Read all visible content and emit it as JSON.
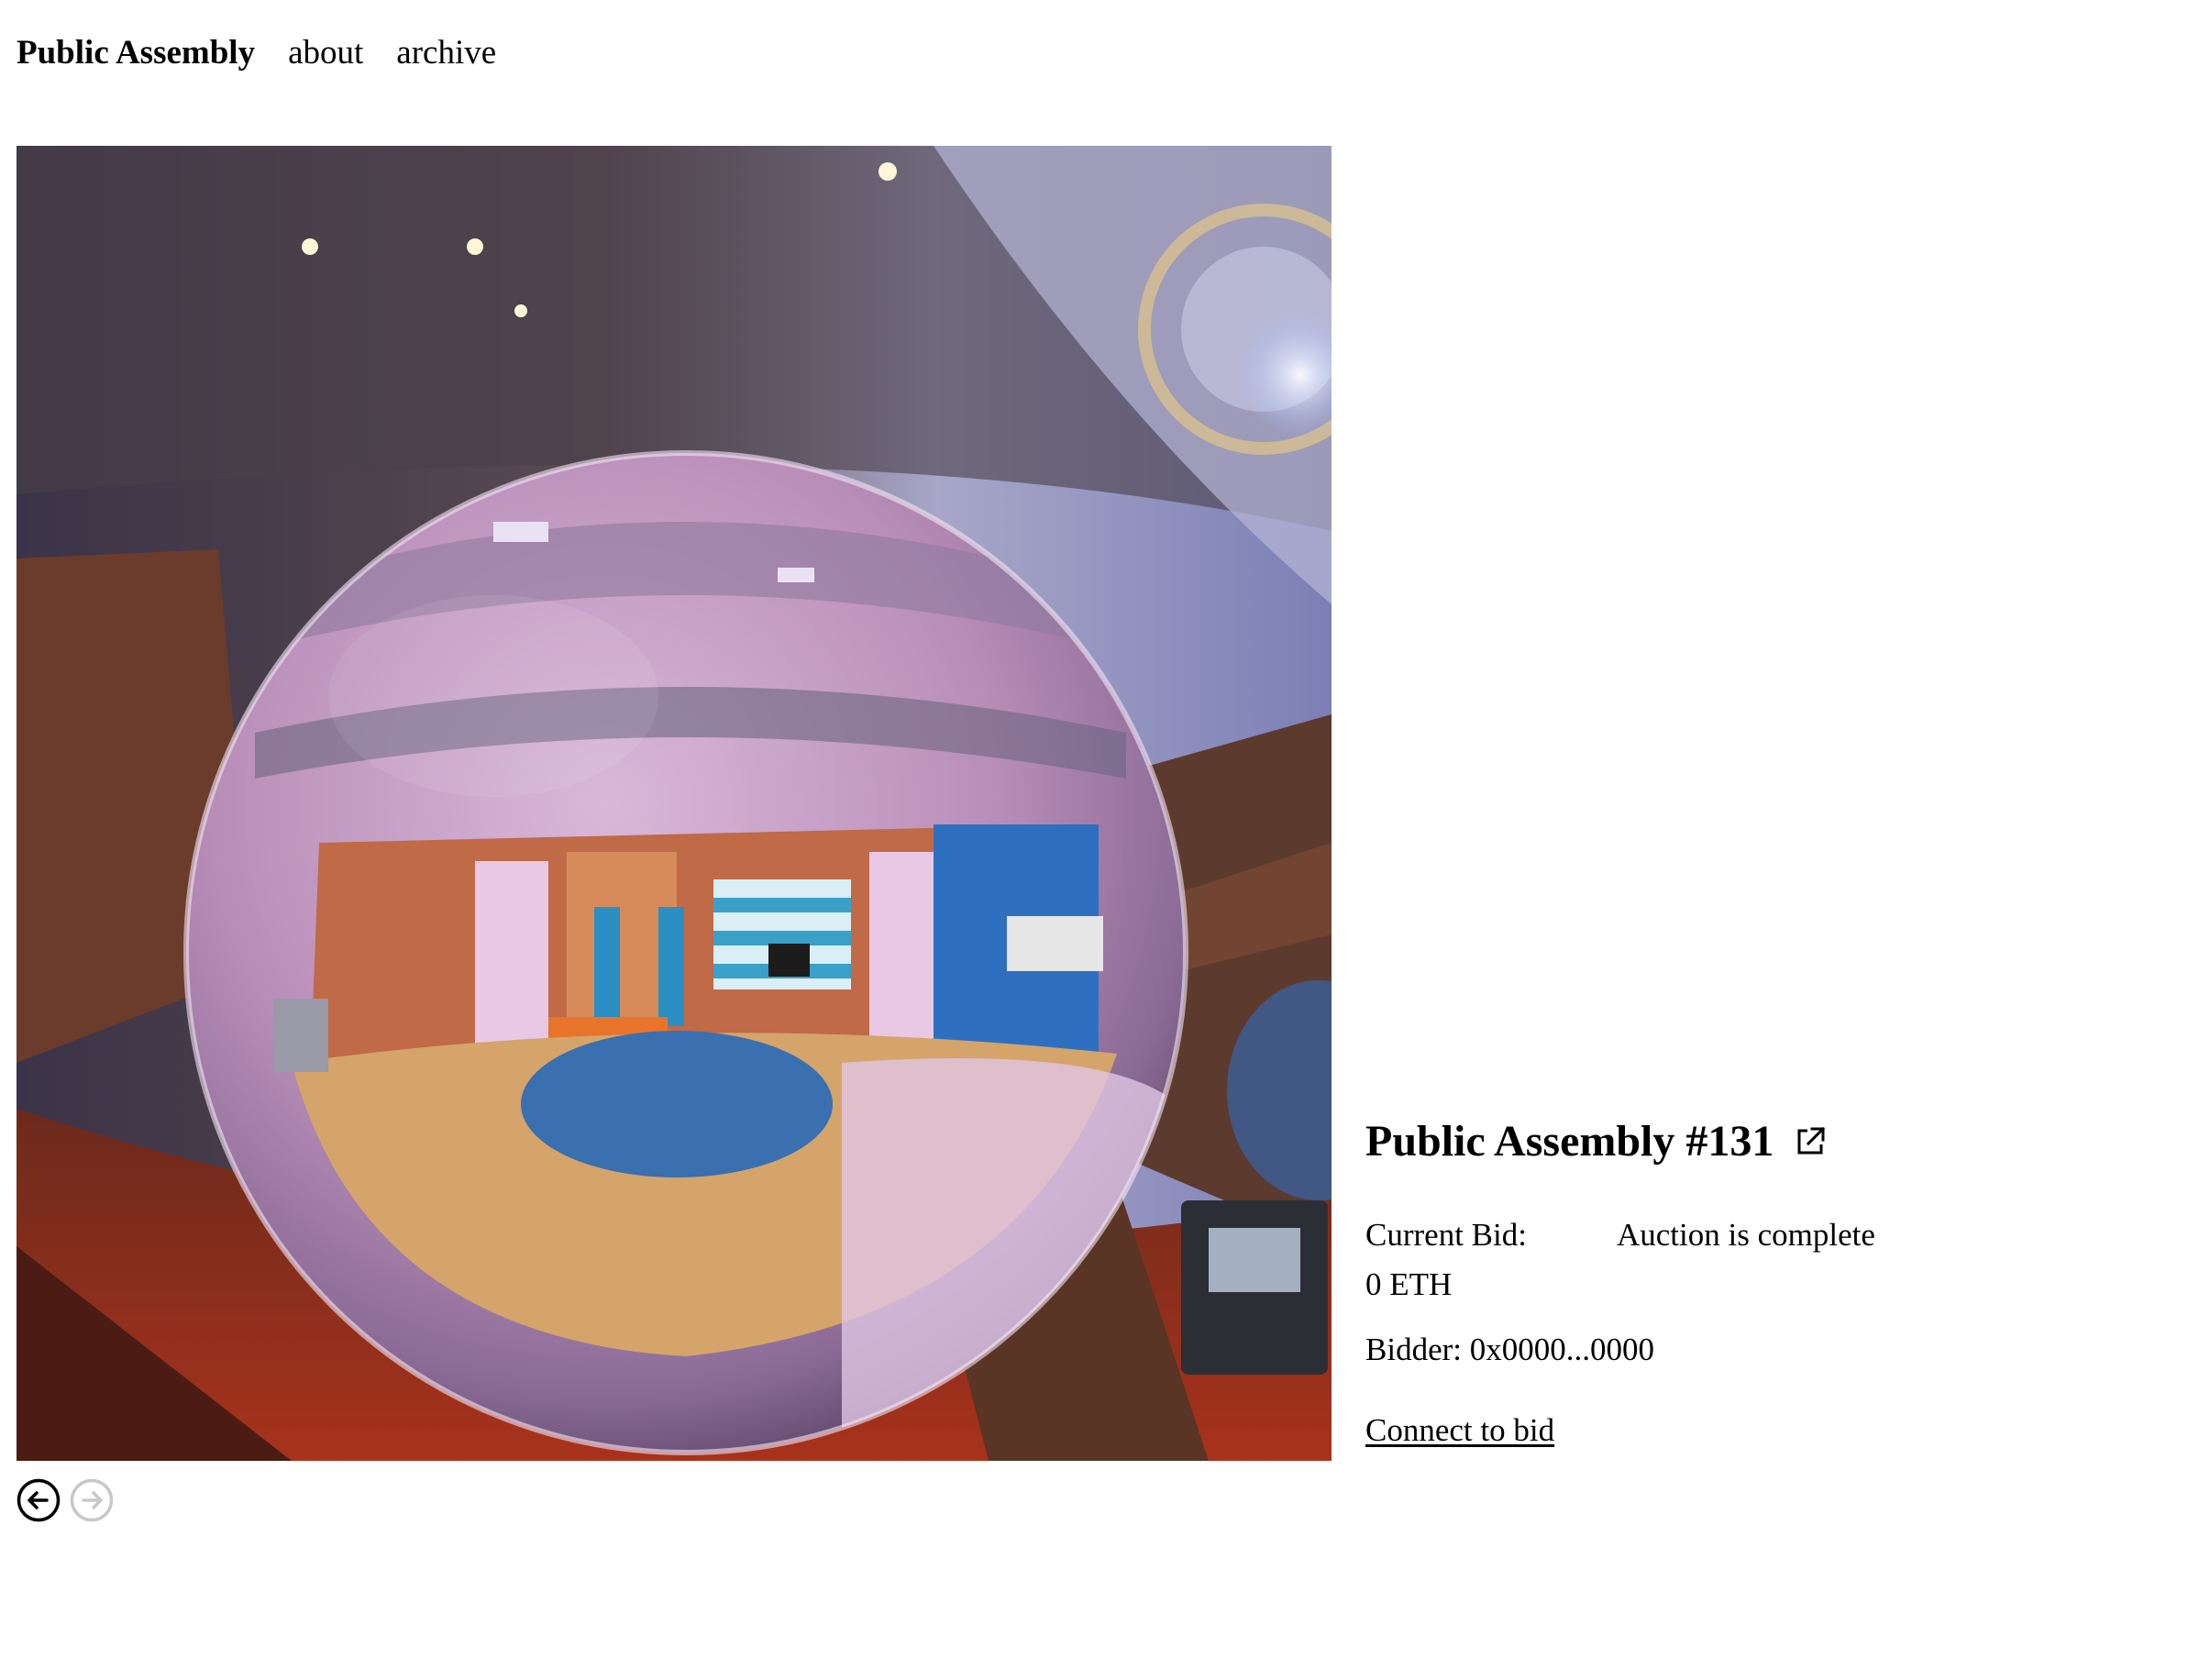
{
  "nav": {
    "brand": "Public Assembly",
    "links": [
      "about",
      "archive"
    ]
  },
  "artwork": {
    "description_icon": "mirror-sphere-artwork"
  },
  "pager": {
    "prev_icon": "arrow-left-circle-icon",
    "next_icon": "arrow-right-circle-icon",
    "next_disabled": true
  },
  "auction": {
    "title": "Public Assembly #131",
    "current_bid_label": "Current Bid:",
    "current_bid_value": "0 ETH",
    "status": "Auction is complete",
    "bidder_text": "Bidder: 0x0000...0000",
    "connect_label": "Connect to bid"
  },
  "colors": {
    "text": "#000000",
    "background": "#ffffff",
    "disabled_arrow": "#c8c8c8"
  }
}
